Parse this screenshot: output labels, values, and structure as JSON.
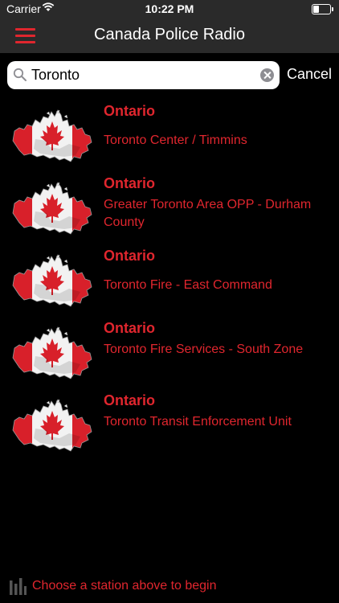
{
  "status": {
    "carrier": "Carrier",
    "time": "10:22 PM",
    "battery_fraction": 0.35
  },
  "nav": {
    "title": "Canada Police Radio",
    "menu_icon": "hamburger-menu-icon"
  },
  "search": {
    "value": "Toronto",
    "placeholder": "Search",
    "cancel_label": "Cancel"
  },
  "stations": [
    {
      "province": "Ontario",
      "name": "Toronto Center / Timmins"
    },
    {
      "province": "Ontario",
      "name": "Greater Toronto Area OPP - Durham County"
    },
    {
      "province": "Ontario",
      "name": "Toronto Fire - East Command"
    },
    {
      "province": "Ontario",
      "name": "Toronto Fire Services - South Zone"
    },
    {
      "province": "Ontario",
      "name": "Toronto Transit Enforcement Unit"
    }
  ],
  "footer": {
    "hint": "Choose a station above to begin"
  },
  "colors": {
    "accent": "#e0262e",
    "bar": "#2a2a2a",
    "background": "#000000"
  }
}
